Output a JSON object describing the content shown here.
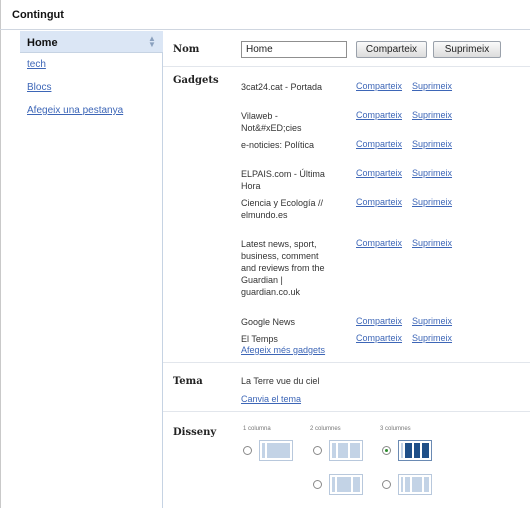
{
  "page_title": "Contingut",
  "sidebar": {
    "selected_tab": "Home",
    "items": [
      {
        "label": "tech"
      },
      {
        "label": "Blocs"
      },
      {
        "label": "Afegeix una pestanya"
      }
    ]
  },
  "sections": {
    "nom": {
      "label": "Nom",
      "value": "Home",
      "share_button": "Comparteix",
      "delete_button": "Suprimeix"
    },
    "gadgets": {
      "label": "Gadgets",
      "items": [
        {
          "name": "3cat24.cat - Portada",
          "share": "Comparteix",
          "delete": "Suprimeix"
        },
        {
          "name": "Vilaweb - Not&#xED;cies",
          "share": "Comparteix",
          "delete": "Suprimeix"
        },
        {
          "name": "e-noticies: Política",
          "share": "Comparteix",
          "delete": "Suprimeix"
        },
        {
          "name": "ELPAIS.com - Última Hora",
          "share": "Comparteix",
          "delete": "Suprimeix"
        },
        {
          "name": "Ciencia y Ecología // elmundo.es",
          "share": "Comparteix",
          "delete": "Suprimeix"
        },
        {
          "name": "Latest news, sport, business, comment and reviews from the Guardian | guardian.co.uk",
          "share": "Comparteix",
          "delete": "Suprimeix"
        },
        {
          "name": "Google News",
          "share": "Comparteix",
          "delete": "Suprimeix"
        },
        {
          "name": "El Temps",
          "share": "Comparteix",
          "delete": "Suprimeix"
        }
      ],
      "add_more": "Afegeix més gadgets"
    },
    "tema": {
      "label": "Tema",
      "current": "La Terre vue du ciel",
      "change_link": "Canvia el tema"
    },
    "disseny": {
      "label": "Disseny",
      "column_labels": [
        "1 columna",
        "2 columnes",
        "3 columnes"
      ],
      "selected_layout": "3 columnes"
    }
  }
}
